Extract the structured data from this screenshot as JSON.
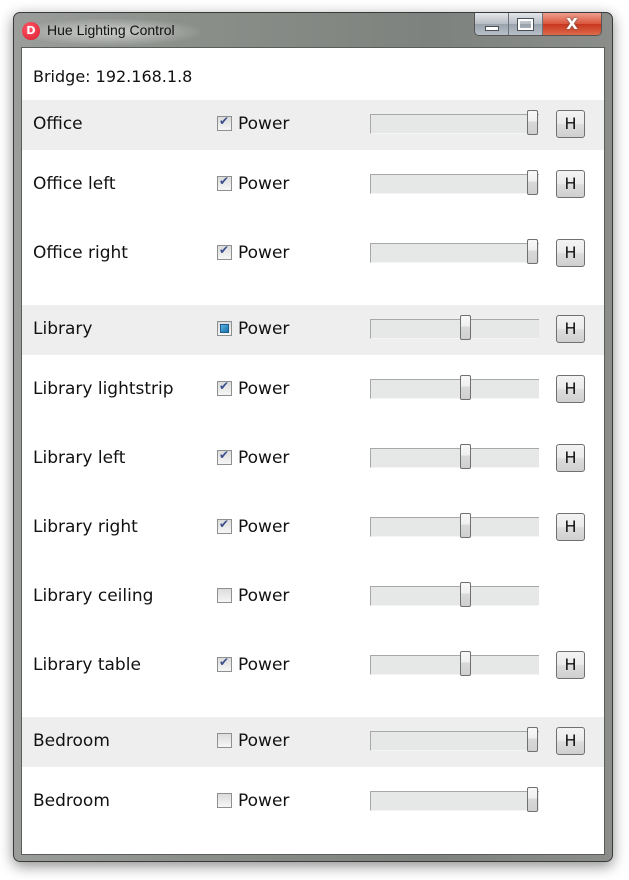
{
  "window": {
    "title": "Hue Lighting Control",
    "app_icon_letter": "D",
    "caption": {
      "minimize": "minimize",
      "maximize": "maximize",
      "close_label": "X"
    }
  },
  "bridge_label": "Bridge: 192.168.1.8",
  "power_label": "Power",
  "hue_button_label": "H",
  "lights": [
    {
      "name": "Office",
      "type": "group",
      "power": "checked",
      "brightness": 1.0,
      "has_hue_button": true
    },
    {
      "name": "Office left",
      "type": "light",
      "power": "checked",
      "brightness": 1.0,
      "has_hue_button": true
    },
    {
      "name": "Office right",
      "type": "light",
      "power": "checked",
      "brightness": 1.0,
      "has_hue_button": true
    },
    {
      "name": "Library",
      "type": "group",
      "power": "indeterminate",
      "brightness": 0.57,
      "has_hue_button": true
    },
    {
      "name": "Library lightstrip",
      "type": "light",
      "power": "checked",
      "brightness": 0.57,
      "has_hue_button": true
    },
    {
      "name": "Library left",
      "type": "light",
      "power": "checked",
      "brightness": 0.57,
      "has_hue_button": true
    },
    {
      "name": "Library right",
      "type": "light",
      "power": "checked",
      "brightness": 0.57,
      "has_hue_button": true
    },
    {
      "name": "Library ceiling",
      "type": "light",
      "power": "unchecked",
      "brightness": 0.57,
      "has_hue_button": false
    },
    {
      "name": "Library table",
      "type": "light",
      "power": "checked",
      "brightness": 0.57,
      "has_hue_button": true
    },
    {
      "name": "Bedroom",
      "type": "group",
      "power": "unchecked",
      "brightness": 1.0,
      "has_hue_button": true
    },
    {
      "name": "Bedroom",
      "type": "light",
      "power": "unchecked",
      "brightness": 1.0,
      "has_hue_button": false
    }
  ]
}
